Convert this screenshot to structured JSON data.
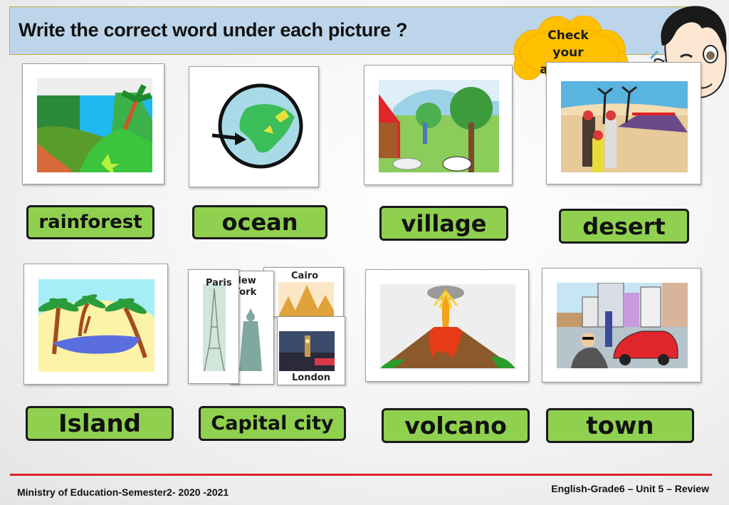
{
  "header": {
    "title": "Write the correct word under each picture ?"
  },
  "check_answers": {
    "line1": "Check",
    "line2": "your",
    "line3": "answers",
    "color": "#ffc000"
  },
  "items": [
    {
      "id": "rainforest",
      "label": "rainforest",
      "picture": "rainforest-illustration"
    },
    {
      "id": "ocean",
      "label": "ocean",
      "picture": "globe-with-arrow-illustration"
    },
    {
      "id": "village",
      "label": "village",
      "picture": "village-farm-illustration"
    },
    {
      "id": "desert",
      "label": "desert",
      "picture": "desert-tent-illustration"
    },
    {
      "id": "island",
      "label": "Island",
      "picture": "island-palms-illustration"
    },
    {
      "id": "capital-city",
      "label": "Capital city",
      "picture": "city-cards-collage"
    },
    {
      "id": "volcano",
      "label": "volcano",
      "picture": "erupting-volcano-illustration"
    },
    {
      "id": "town",
      "label": "town",
      "picture": "town-street-illustration"
    }
  ],
  "cities": {
    "paris": "Paris",
    "new_york_line1": "New",
    "new_york_line2": "York",
    "cairo": "Cairo",
    "london": "London"
  },
  "label_color": "#8fd14f",
  "footer": {
    "left": "Ministry of Education-Semester2- 2020 -2021",
    "right": "English-Grade6 – Unit 5 – Review",
    "line_color": "#d9262c"
  }
}
